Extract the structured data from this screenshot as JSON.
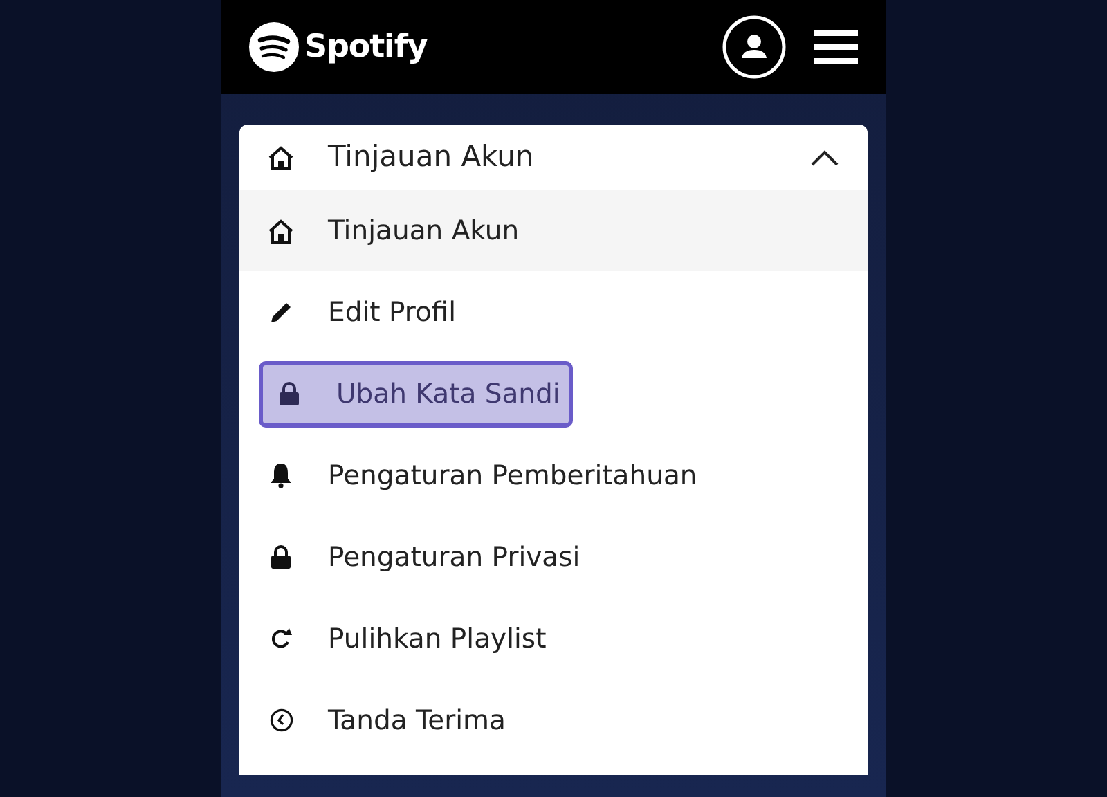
{
  "header": {
    "logo_text": "Spotify"
  },
  "menu": {
    "title": "Tinjauan Akun",
    "expanded": true,
    "items": [
      {
        "label": "Tinjauan Akun",
        "selected": true,
        "focused": false
      },
      {
        "label": "Edit Profil",
        "selected": false,
        "focused": false
      },
      {
        "label": "Ubah Kata Sandi",
        "selected": false,
        "focused": true
      },
      {
        "label": "Pengaturan Pemberitahuan",
        "selected": false,
        "focused": false
      },
      {
        "label": "Pengaturan Privasi",
        "selected": false,
        "focused": false
      },
      {
        "label": "Pulihkan Playlist",
        "selected": false,
        "focused": false
      },
      {
        "label": "Tanda Terima",
        "selected": false,
        "focused": false
      }
    ]
  }
}
